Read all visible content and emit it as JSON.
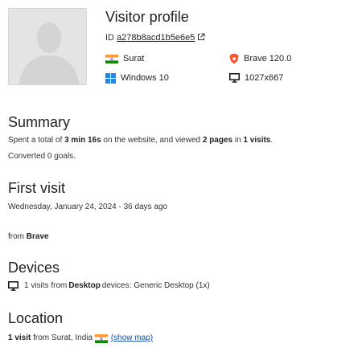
{
  "profile": {
    "title": "Visitor profile",
    "id_label": "ID",
    "id_value": "a278b8acd1b5e6e5",
    "city": "Surat",
    "browser": "Brave 120.0",
    "os": "Windows 10",
    "resolution": "1027x667"
  },
  "summary": {
    "heading": "Summary",
    "line1_pre": "Spent a total of ",
    "duration": "3 min 16s",
    "line1_mid": " on the website, and viewed ",
    "pages": "2 pages",
    "line1_in": " in ",
    "visits": "1 visits",
    "line1_end": ".",
    "goals": "Converted 0 goals."
  },
  "first_visit": {
    "heading": "First visit",
    "date": "Wednesday, January 24, 2024",
    "ago": " - 36 days ago",
    "from_pre": "from ",
    "from_browser": "Brave"
  },
  "devices": {
    "heading": "Devices",
    "pre": "1 visits from ",
    "device_type": "Desktop",
    "post": " devices: Generic Desktop (1x)"
  },
  "location": {
    "heading": "Location",
    "visits": "1 visit",
    "from_text": " from Surat, India ",
    "show_map": "(show map)"
  },
  "colors": {
    "flag_saffron": "#ff9933",
    "flag_green": "#138808",
    "windows_blue": "#1e88e5",
    "brave_orange": "#fb542b",
    "link_blue": "#1a4fa0"
  },
  "icons": {
    "external": "external-link-icon",
    "flag": "india-flag-icon",
    "browser": "brave-icon",
    "os": "windows-icon",
    "resolution": "monitor-icon",
    "device": "desktop-icon"
  }
}
